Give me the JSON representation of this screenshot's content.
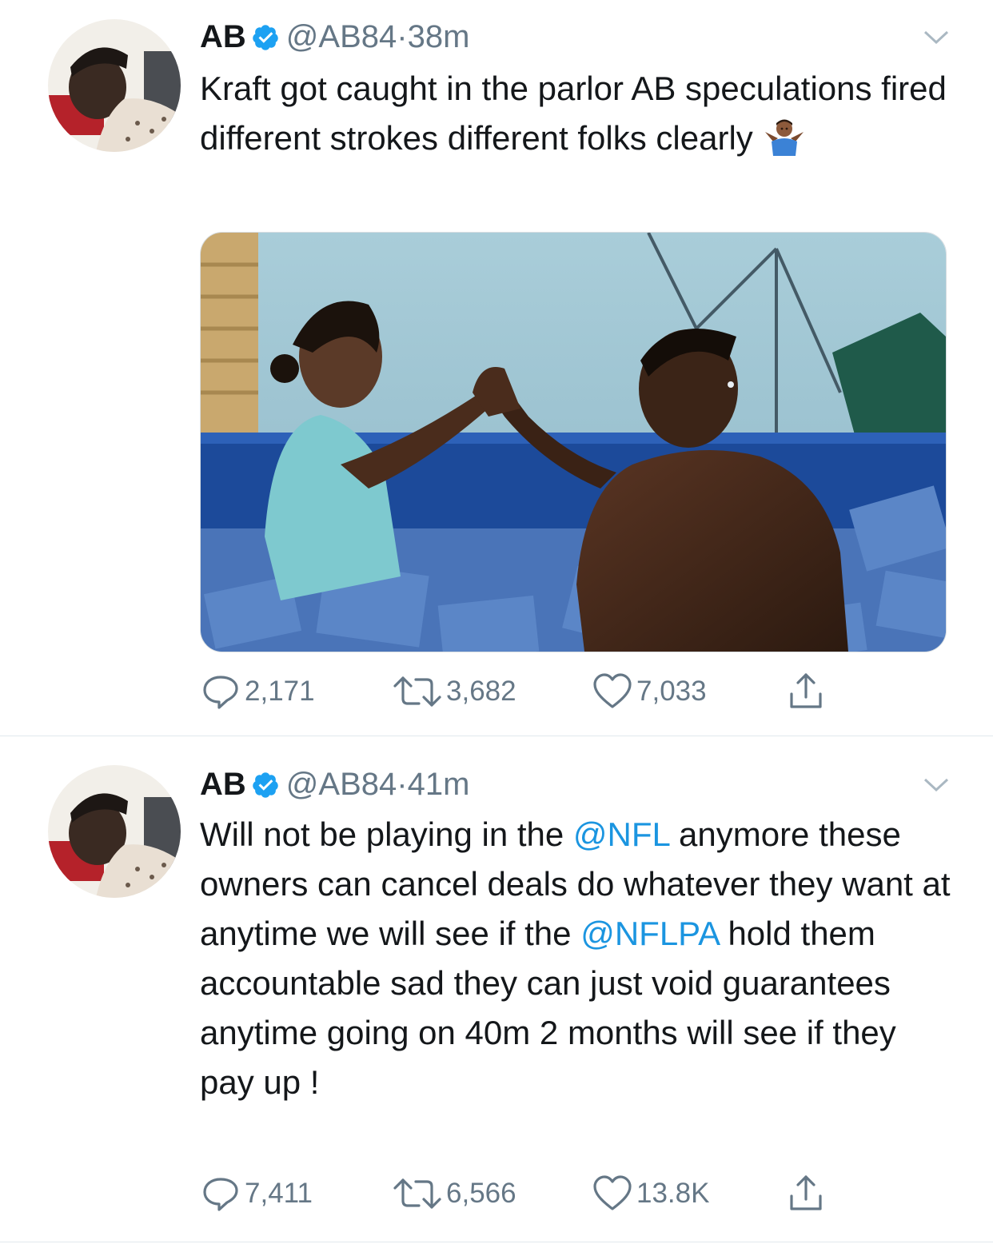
{
  "colors": {
    "link": "#1b95e0",
    "muted": "#657786",
    "verified": "#1da1f2"
  },
  "tweets": [
    {
      "name": "AB",
      "handle": "@AB84",
      "separator": "·",
      "time": "38m",
      "text_parts": [
        {
          "text": "Kraft got caught in the parlor AB speculations fired different strokes different folks clearly "
        }
      ],
      "emoji_icon": "man-shrugging-emoji-icon",
      "has_media": true,
      "media_icon": "photo-two-people-high-five-in-foam-pit",
      "replies": "2,171",
      "retweets": "3,682",
      "likes": "7,033"
    },
    {
      "name": "AB",
      "handle": "@AB84",
      "separator": "·",
      "time": "41m",
      "text_parts": [
        {
          "text": "Will not be playing in the "
        },
        {
          "text": "@NFL",
          "mention": true
        },
        {
          "text": " anymore these owners can cancel deals do whatever they want at anytime we will see if the "
        },
        {
          "text": "@NFLPA",
          "mention": true
        },
        {
          "text": " hold them accountable sad they can just void guarantees anytime going on 40m 2 months will see if they pay up !"
        }
      ],
      "has_media": false,
      "replies": "7,411",
      "retweets": "6,566",
      "likes": "13.8K"
    }
  ]
}
